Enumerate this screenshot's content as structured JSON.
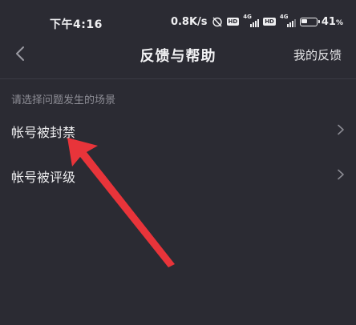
{
  "status_bar": {
    "time": "下午4:16",
    "net_speed": "0.8K/s",
    "network_label": "4G",
    "hd_label": "HD",
    "battery_percent": "41",
    "battery_level": 0.41
  },
  "nav": {
    "title": "反馈与帮助",
    "right_action": "我的反馈"
  },
  "section": {
    "hint": "请选择问题发生的场景",
    "items": [
      {
        "label": "帐号被封禁"
      },
      {
        "label": "帐号被评级"
      }
    ]
  },
  "colors": {
    "background": "#2b2b33",
    "annotation_arrow": "#e8343a"
  }
}
